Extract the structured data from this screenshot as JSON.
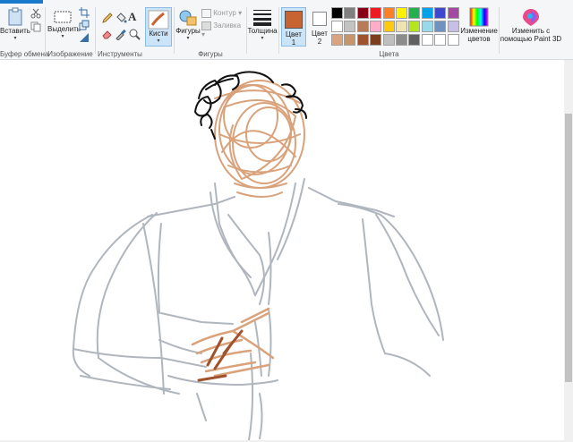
{
  "ribbon": {
    "clipboard": {
      "paste_label": "Вставить",
      "group_label": "Буфер обмена"
    },
    "image": {
      "select_label": "Выделить",
      "group_label": "Изображение"
    },
    "tools": {
      "group_label": "Инструменты"
    },
    "brushes": {
      "label": "Кисти"
    },
    "shapes": {
      "label": "Фигуры",
      "outline_label": "Контур",
      "fill_label": "Заливка",
      "group_label": "Фигуры"
    },
    "size": {
      "label": "Толщина"
    },
    "colors": {
      "color1_label": "Цвет",
      "color1_num": "1",
      "color2_label": "Цвет",
      "color2_num": "2",
      "edit_label_1": "Изменение",
      "edit_label_2": "цветов",
      "group_label": "Цвета",
      "color1": "#c86432",
      "color2": "#ffffff",
      "palette_row1": [
        "#000000",
        "#7f7f7f",
        "#880015",
        "#ed1c24",
        "#ff7f27",
        "#fff200",
        "#22b14c",
        "#00a2e8",
        "#3f48cc",
        "#a349a4"
      ],
      "palette_row2": [
        "#ffffff",
        "#c3c3c3",
        "#b97a57",
        "#ffaec9",
        "#ffc90e",
        "#efe4b0",
        "#b5e61d",
        "#99d9ea",
        "#7092be",
        "#c8bfe7"
      ],
      "palette_row3": [
        "#dba47e",
        "#c8956a",
        "#a0522d",
        "#7b3f1e",
        "#bfbfbf",
        "#8c8c8c",
        "#606060",
        "#ffffff",
        "#ffffff",
        "#ffffff"
      ]
    },
    "paint3d": {
      "label_1": "Изменить с",
      "label_2": "помощью Paint 3D"
    }
  },
  "drawing": {
    "subject": "sketch-of-person",
    "hair_color": "#111111",
    "skin_color": "#d9a27b",
    "clothes_color": "#b0b6bd",
    "brush_color": "#a0522d"
  }
}
